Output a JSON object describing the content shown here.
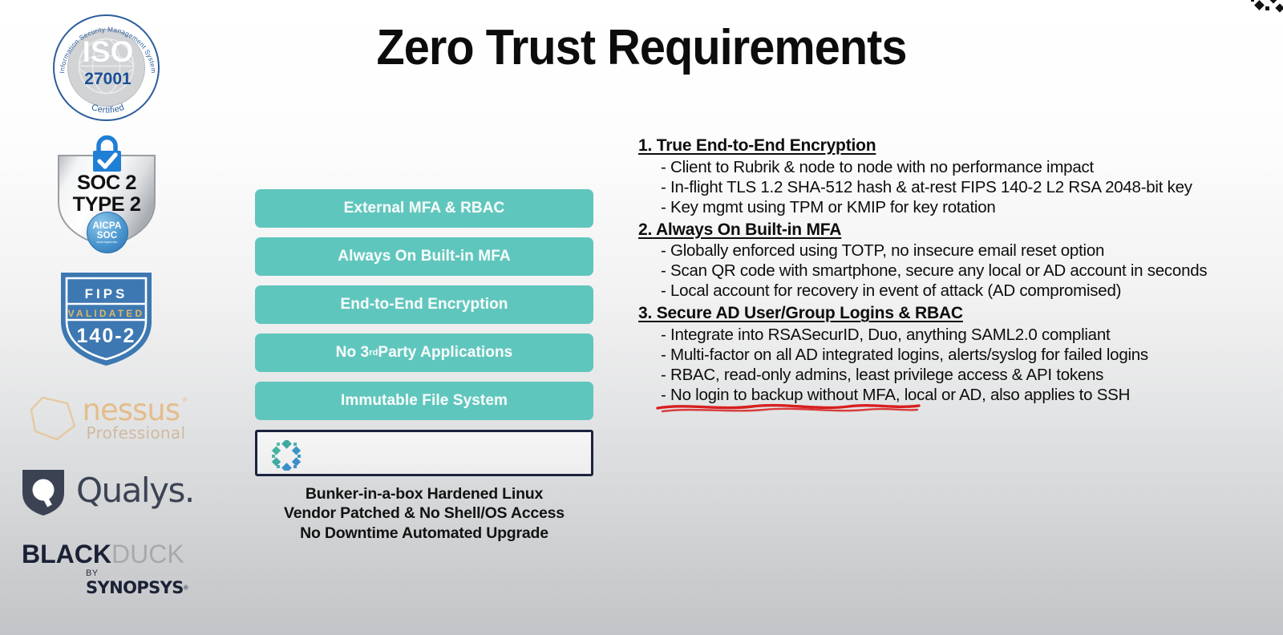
{
  "slide": {
    "title": "Zero Trust Requirements",
    "background_top": "#ffffff",
    "background_bottom": "#c2c4c7",
    "accent_teal": "#5fc6bd",
    "highlight_red": "#d81f1f"
  },
  "corner_logo": {
    "name": "rubrik-logo"
  },
  "badges": [
    {
      "name": "iso-27001-badge",
      "arc_text": "Information Security Management System",
      "main": "ISO",
      "number": "27001",
      "bottom": "Certified"
    },
    {
      "name": "soc-2-type-2-badge",
      "line1": "SOC 2",
      "line2": "TYPE 2",
      "seal_line1": "AICPA",
      "seal_line2": "SOC",
      "seal_line3": "aicpa.org/soc4so"
    },
    {
      "name": "fips-140-2-badge",
      "line1": "FIPS",
      "line2": "VALIDATED",
      "line3": "140-2"
    },
    {
      "name": "nessus-professional-logo",
      "word": "nessus",
      "registered": "®",
      "sub": "Professional"
    },
    {
      "name": "qualys-logo",
      "word": "Qualys."
    },
    {
      "name": "black-duck-logo",
      "word_bold": "BLACK",
      "word_light": "DUCK",
      "by": "BY",
      "parent": "SYNOPSYS",
      "registered": "®"
    }
  ],
  "pills": [
    {
      "label": "External MFA & RBAC"
    },
    {
      "label": "Always On Built-in MFA"
    },
    {
      "label": "End-to-End Encryption"
    },
    {
      "label": "No 3",
      "sup": "rd",
      "label_tail": " Party Applications"
    },
    {
      "label": "Immutable File System"
    }
  ],
  "bunker": {
    "logo_name": "rubrik-logo",
    "caption_line1": "Bunker-in-a-box Hardened Linux",
    "caption_line2": "Vendor Patched & No Shell/OS Access",
    "caption_line3": "No Downtime Automated Upgrade"
  },
  "requirements": [
    {
      "heading": "1. True End-to-End Encryption",
      "bullets": [
        "-  Client to Rubrik & node to node with no performance impact",
        "-  In-flight TLS 1.2 SHA-512 hash & at-rest FIPS 140-2 L2 RSA 2048-bit key",
        "-  Key mgmt using TPM or KMIP for key rotation"
      ]
    },
    {
      "heading": "2. Always On Built-in MFA",
      "bullets": [
        "-  Globally enforced using TOTP, no insecure email reset option",
        "-  Scan QR code with smartphone, secure any local or AD account in seconds",
        "-  Local account for recovery in event of attack (AD compromised)"
      ]
    },
    {
      "heading": "3. Secure AD User/Group Logins & RBAC",
      "bullets": [
        "-  Integrate into RSASecurID, Duo, anything SAML2.0 compliant",
        "-  Multi-factor on all AD integrated logins, alerts/syslog for failed logins",
        "-  RBAC, read-only admins, least privilege access & API tokens",
        "-  No login to backup without MFA, local or AD, also applies to SSH"
      ]
    }
  ]
}
